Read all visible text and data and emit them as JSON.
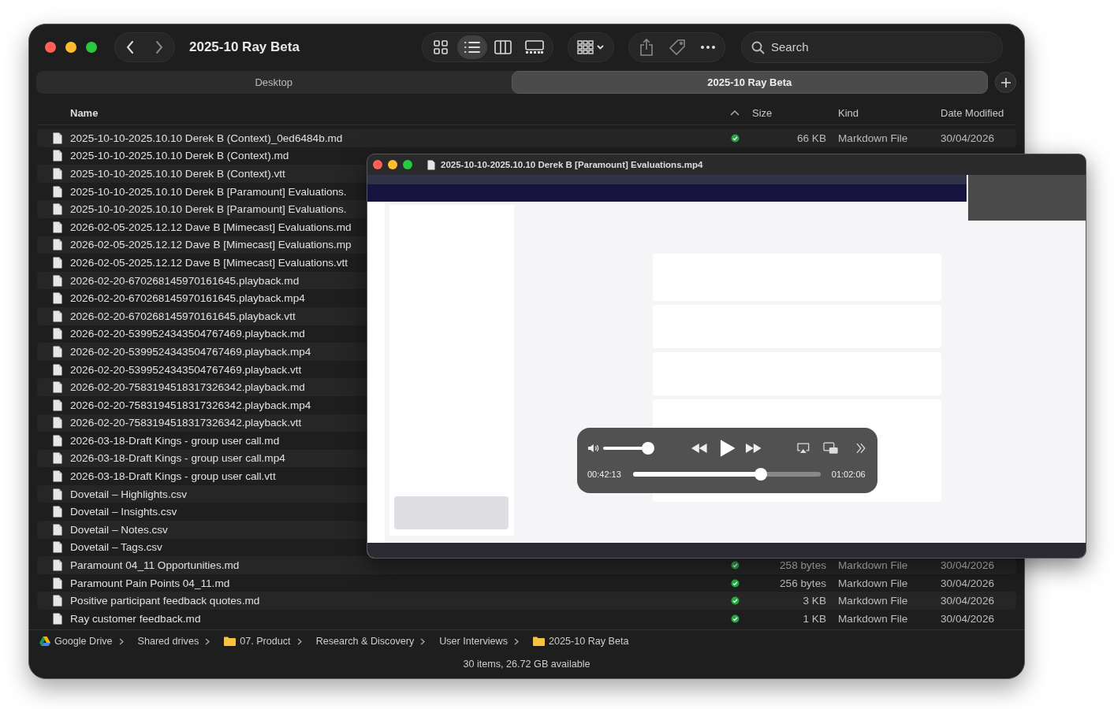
{
  "window": {
    "title": "2025-10 Ray Beta"
  },
  "toolbar": {
    "view_modes": [
      {
        "kind": "icons",
        "selected": false
      },
      {
        "kind": "list",
        "selected": true
      },
      {
        "kind": "columns",
        "selected": false
      },
      {
        "kind": "gallery",
        "selected": false
      }
    ],
    "search": {
      "placeholder": "Search"
    }
  },
  "tabs": [
    {
      "label": "Desktop",
      "selected": false
    },
    {
      "label": "2025-10 Ray Beta",
      "selected": true
    }
  ],
  "columns": [
    {
      "label": "Name"
    },
    {
      "label": "Size"
    },
    {
      "label": "Kind"
    },
    {
      "label": "Date Modified"
    }
  ],
  "files": [
    {
      "name": "2025-10-10-2025.10.10 Derek B (Context)_0ed6484b.md",
      "synced": true,
      "size": "66 KB",
      "kind": "Markdown File",
      "date": "30/04/2026"
    },
    {
      "name": "2025-10-10-2025.10.10 Derek B (Context).md"
    },
    {
      "name": "2025-10-10-2025.10.10 Derek B (Context).vtt"
    },
    {
      "name": "2025-10-10-2025.10.10 Derek B [Paramount] Evaluations."
    },
    {
      "name": "2025-10-10-2025.10.10 Derek B [Paramount] Evaluations."
    },
    {
      "name": "2026-02-05-2025.12.12 Dave B [Mimecast] Evaluations.md"
    },
    {
      "name": "2026-02-05-2025.12.12 Dave B [Mimecast] Evaluations.mp"
    },
    {
      "name": "2026-02-05-2025.12.12 Dave B [Mimecast] Evaluations.vtt"
    },
    {
      "name": "2026-02-20-670268145970161645.playback.md"
    },
    {
      "name": "2026-02-20-670268145970161645.playback.mp4"
    },
    {
      "name": "2026-02-20-670268145970161645.playback.vtt"
    },
    {
      "name": "2026-02-20-5399524343504767469.playback.md"
    },
    {
      "name": "2026-02-20-5399524343504767469.playback.mp4"
    },
    {
      "name": "2026-02-20-5399524343504767469.playback.vtt"
    },
    {
      "name": "2026-02-20-7583194518317326342.playback.md"
    },
    {
      "name": "2026-02-20-7583194518317326342.playback.mp4"
    },
    {
      "name": "2026-02-20-7583194518317326342.playback.vtt"
    },
    {
      "name": "2026-03-18-Draft Kings - group user call.md"
    },
    {
      "name": "2026-03-18-Draft Kings - group user call.mp4"
    },
    {
      "name": "2026-03-18-Draft Kings - group user call.vtt"
    },
    {
      "name": "Dovetail – Highlights.csv"
    },
    {
      "name": "Dovetail – Insights.csv"
    },
    {
      "name": "Dovetail – Notes.csv"
    },
    {
      "name": "Dovetail – Tags.csv"
    },
    {
      "name": "Paramount 04_11 Opportunities.md",
      "synced": true,
      "size": "258 bytes",
      "kind": "Markdown File",
      "date": "30/04/2026"
    },
    {
      "name": "Paramount Pain Points 04_11.md",
      "synced": true,
      "size": "256 bytes",
      "kind": "Markdown File",
      "date": "30/04/2026"
    },
    {
      "name": "Positive participant feedback quotes.md",
      "synced": true,
      "size": "3 KB",
      "kind": "Markdown File",
      "date": "30/04/2026"
    },
    {
      "name": "Ray customer feedback.md",
      "synced": true,
      "size": "1 KB",
      "kind": "Markdown File",
      "date": "30/04/2026"
    }
  ],
  "path_bar": [
    {
      "label": "Google Drive",
      "kind": "drive"
    },
    {
      "label": "Shared drives",
      "kind": "plain"
    },
    {
      "label": "07. Product",
      "kind": "folder"
    },
    {
      "label": "Research & Discovery",
      "kind": "plain"
    },
    {
      "label": "User Interviews",
      "kind": "plain"
    },
    {
      "label": "2025-10 Ray Beta",
      "kind": "folder"
    }
  ],
  "status_bar": "30 items, 26.72 GB available",
  "video_window": {
    "title": "2025-10-10-2025.10.10 Derek B [Paramount] Evaluations.mp4",
    "player": {
      "volume": {
        "level": 0.9
      },
      "progress": {
        "level": 0.68
      },
      "elapsed": "00:42:13",
      "duration": "01:02:06"
    }
  }
}
